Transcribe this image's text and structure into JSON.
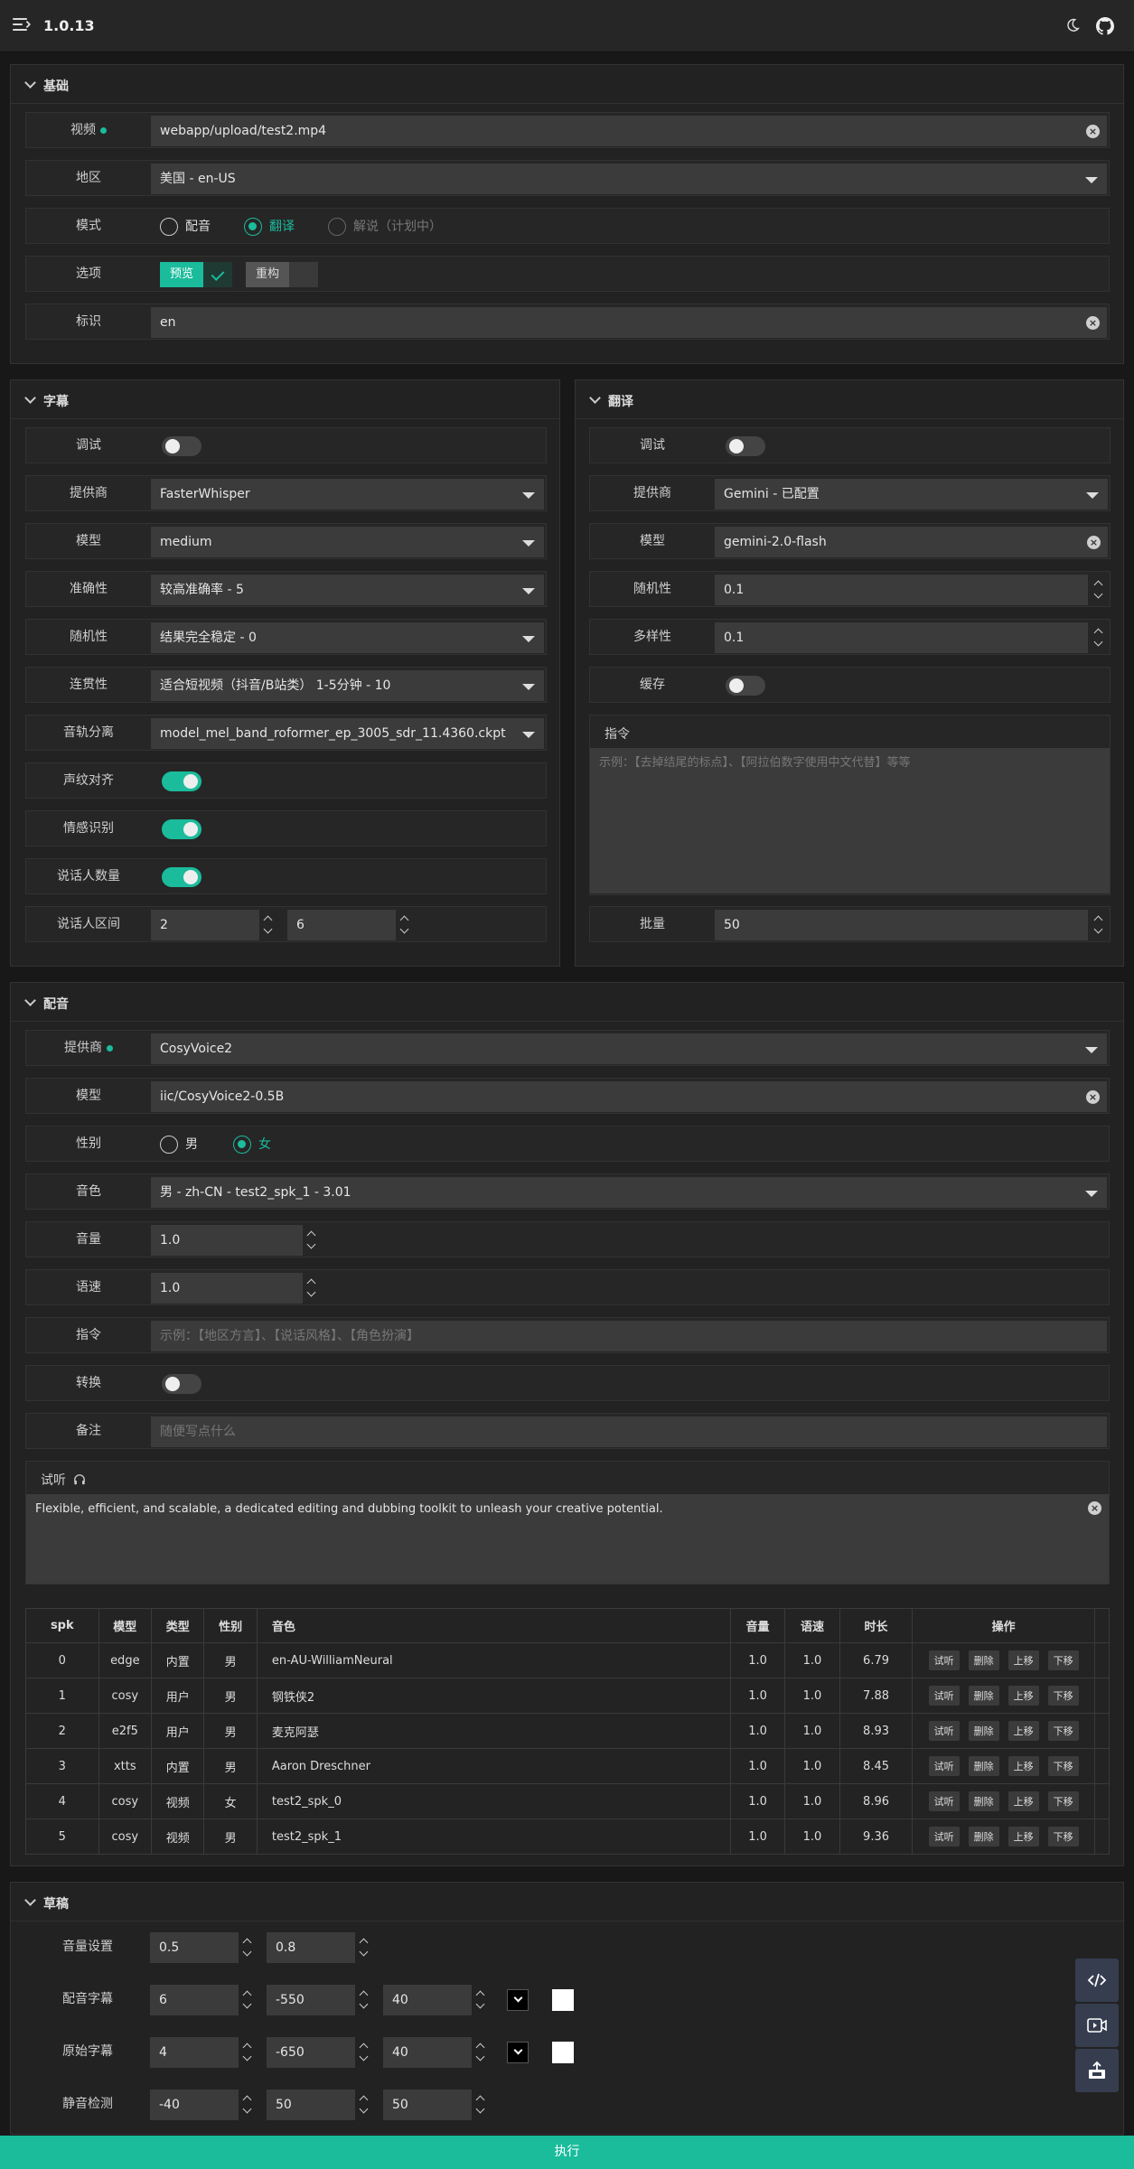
{
  "app": {
    "version": "1.0.13"
  },
  "icons": {
    "menu": "menu-icon",
    "theme": "moon-icon",
    "github": "github-icon"
  },
  "basic": {
    "title": "基础",
    "video": {
      "label": "视频",
      "value": "webapp/upload/test2.mp4"
    },
    "region": {
      "label": "地区",
      "value": "美国 - en-US"
    },
    "mode": {
      "label": "模式",
      "options": [
        "配音",
        "翻译",
        "解说（计划中）"
      ],
      "selected": "翻译"
    },
    "options": {
      "label": "选项",
      "preview": "预览",
      "rebuild": "重构"
    },
    "tag": {
      "label": "标识",
      "value": "en"
    }
  },
  "subtitle": {
    "title": "字幕",
    "debug": {
      "label": "调试",
      "on": false
    },
    "provider": {
      "label": "提供商",
      "value": "FasterWhisper"
    },
    "model": {
      "label": "模型",
      "value": "medium"
    },
    "accuracy": {
      "label": "准确性",
      "value": "较高准确率 - 5"
    },
    "randomness": {
      "label": "随机性",
      "value": "结果完全稳定 - 0"
    },
    "coherence": {
      "label": "连贯性",
      "value": "适合短视频（抖音/B站类） 1-5分钟 - 10"
    },
    "separation": {
      "label": "音轨分离",
      "value": "model_mel_band_roformer_ep_3005_sdr_11.4360.ckpt"
    },
    "voiceprint": {
      "label": "声纹对齐",
      "on": true
    },
    "emotion": {
      "label": "情感识别",
      "on": true
    },
    "speaker_count": {
      "label": "说话人数量",
      "on": true
    },
    "speaker_range": {
      "label": "说话人区间",
      "min": "2",
      "max": "6"
    }
  },
  "translate": {
    "title": "翻译",
    "debug": {
      "label": "调试",
      "on": false
    },
    "provider": {
      "label": "提供商",
      "value": "Gemini - 已配置"
    },
    "model": {
      "label": "模型",
      "value": "gemini-2.0-flash"
    },
    "randomness": {
      "label": "随机性",
      "value": "0.1"
    },
    "diversity": {
      "label": "多样性",
      "value": "0.1"
    },
    "cache": {
      "label": "缓存",
      "on": false
    },
    "instruction": {
      "label": "指令",
      "placeholder": "示例：【去掉结尾的标点】、【阿拉伯数字使用中文代替】等等"
    },
    "batch": {
      "label": "批量",
      "value": "50"
    }
  },
  "dubbing": {
    "title": "配音",
    "provider": {
      "label": "提供商",
      "value": "CosyVoice2"
    },
    "model": {
      "label": "模型",
      "value": "iic/CosyVoice2-0.5B"
    },
    "gender": {
      "label": "性别",
      "options": [
        "男",
        "女"
      ],
      "selected": "女"
    },
    "voice": {
      "label": "音色",
      "value": "男 - zh-CN - test2_spk_1 - 3.01"
    },
    "volume": {
      "label": "音量",
      "value": "1.0"
    },
    "speed": {
      "label": "语速",
      "value": "1.0"
    },
    "instruction": {
      "label": "指令",
      "placeholder": "示例：【地区方言】、【说话风格】、【角色扮演】"
    },
    "convert": {
      "label": "转换",
      "on": false
    },
    "note": {
      "label": "备注",
      "placeholder": "随便写点什么"
    },
    "trial": {
      "label": "试听",
      "text": "Flexible, efficient, and scalable, a dedicated editing and dubbing toolkit to unleash your creative potential."
    },
    "table": {
      "headers": [
        "spk",
        "模型",
        "类型",
        "性别",
        "音色",
        "音量",
        "语速",
        "时长",
        "操作"
      ],
      "actions": [
        "试听",
        "删除",
        "上移",
        "下移"
      ],
      "rows": [
        [
          "0",
          "edge",
          "内置",
          "男",
          "en-AU-WilliamNeural",
          "1.0",
          "1.0",
          "6.79"
        ],
        [
          "1",
          "cosy",
          "用户",
          "男",
          "钢铁侠2",
          "1.0",
          "1.0",
          "7.88"
        ],
        [
          "2",
          "e2f5",
          "用户",
          "男",
          "麦克阿瑟",
          "1.0",
          "1.0",
          "8.93"
        ],
        [
          "3",
          "xtts",
          "内置",
          "男",
          "Aaron Dreschner",
          "1.0",
          "1.0",
          "8.45"
        ],
        [
          "4",
          "cosy",
          "视频",
          "女",
          "test2_spk_0",
          "1.0",
          "1.0",
          "8.96"
        ],
        [
          "5",
          "cosy",
          "视频",
          "男",
          "test2_spk_1",
          "1.0",
          "1.0",
          "9.36"
        ]
      ]
    }
  },
  "draft": {
    "title": "草稿",
    "volume_settings": {
      "label": "音量设置",
      "values": [
        "0.5",
        "0.8"
      ]
    },
    "dub_subtitle": {
      "label": "配音字幕",
      "values": [
        "6",
        "-550",
        "40"
      ],
      "color": "#000000",
      "bg": "#ffffff"
    },
    "orig_subtitle": {
      "label": "原始字幕",
      "values": [
        "4",
        "-650",
        "40"
      ],
      "color": "#000000",
      "bg": "#ffffff"
    },
    "silence": {
      "label": "静音检测",
      "values": [
        "-40",
        "50",
        "50"
      ]
    }
  },
  "side": [
    "code-icon",
    "video-icon",
    "export-icon"
  ],
  "execute": "执行",
  "colors": {
    "accent": "#1abc9c",
    "bg": "#181818",
    "panel": "#222222",
    "control": "#3b3b3b"
  }
}
